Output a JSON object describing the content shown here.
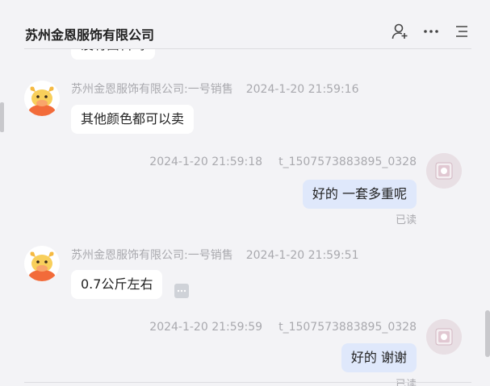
{
  "header": {
    "title": "苏州金恩服饰有限公司"
  },
  "messages": [
    {
      "partial_text": "没有面料吗"
    },
    {
      "sender": "苏州金恩服饰有限公司:一号销售",
      "time": "2024-1-20 21:59:16",
      "text": "其他颜色都可以卖"
    },
    {
      "sender": "t_1507573883895_0328",
      "time": "2024-1-20 21:59:18",
      "text": "好的 一套多重呢",
      "status": "已读"
    },
    {
      "sender": "苏州金恩服饰有限公司:一号销售",
      "time": "2024-1-20 21:59:51",
      "text": "0.7公斤左右"
    },
    {
      "sender": "t_1507573883895_0328",
      "time": "2024-1-20 21:59:59",
      "text": "好的 谢谢",
      "status": "已读"
    }
  ],
  "icons": {
    "add_contact": "add-user-icon",
    "more": "more-dots-icon",
    "menu": "list-menu-icon",
    "message_more": "ellipsis-icon"
  },
  "colors": {
    "background": "#f3f3f6",
    "incoming_bubble": "#ffffff",
    "outgoing_bubble": "#dfe8fb",
    "meta_text": "#a9a9ae",
    "avatar_orange": "#f26b3a"
  }
}
